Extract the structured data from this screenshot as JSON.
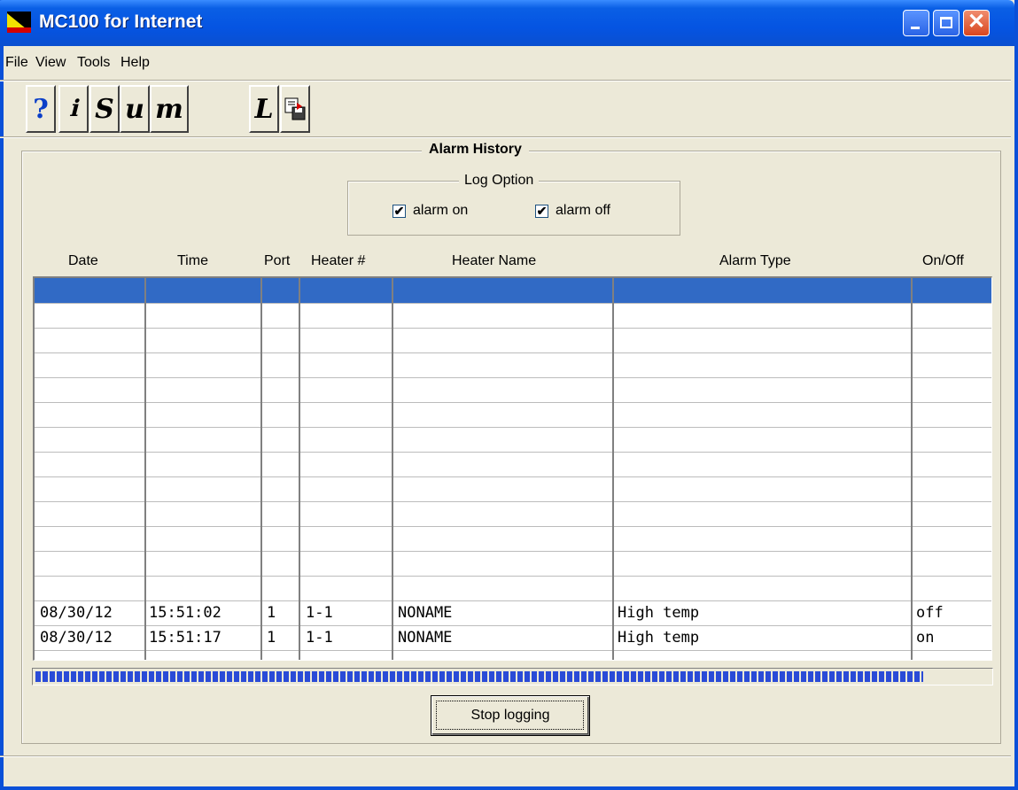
{
  "window": {
    "title": "MC100 for Internet",
    "title_bar_color": "#0554e2"
  },
  "menu": [
    "File",
    "View",
    "Tools",
    "Help"
  ],
  "toolbar": {
    "help_glyph": "?",
    "info_glyph": "ℹ",
    "s_glyph": "S",
    "u_glyph": "u",
    "m_glyph": "m",
    "l_glyph": "L",
    "save_icon": "save-log-icon"
  },
  "alarm_history": {
    "title": "Alarm History",
    "log_option": {
      "title": "Log Option",
      "alarm_on_label": "alarm on",
      "alarm_on_checked": true,
      "alarm_off_label": "alarm off",
      "alarm_off_checked": true
    },
    "columns": [
      "Date",
      "Time",
      "Port",
      "Heater #",
      "Heater Name",
      "Alarm Type",
      "On/Off"
    ],
    "rows": [
      [
        "08/30/12",
        "15:51:02",
        "1",
        "1-1",
        "NONAME",
        "High temp",
        "off"
      ],
      [
        "08/30/12",
        "15:51:17",
        "1",
        "1-1",
        "NONAME",
        "High temp",
        "on"
      ]
    ],
    "selected_color": "#316ac5",
    "progress_fraction": 0.93,
    "stop_button_label": "Stop logging"
  }
}
